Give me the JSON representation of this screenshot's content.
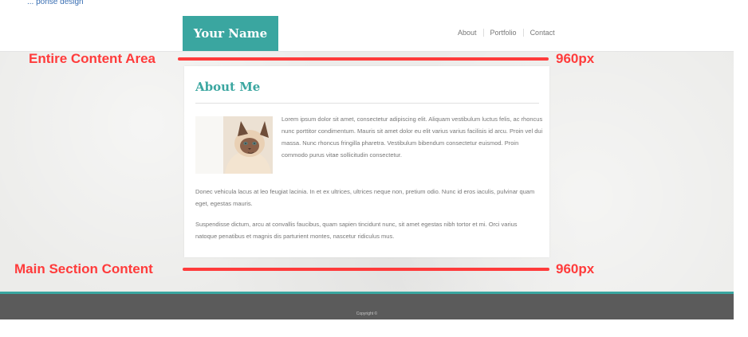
{
  "top_link": "... ponse design",
  "header": {
    "logo": "Your Name",
    "nav": [
      "About",
      "Portfolio",
      "Contact"
    ]
  },
  "main": {
    "title": "About Me",
    "paragraphs": [
      "Lorem ipsum dolor sit amet, consectetur adipiscing elit. Aliquam vestibulum luctus felis, ac rhoncus nunc porttitor condimentum. Mauris sit amet dolor eu elit varius varius facilisis id arcu. Proin vel dui massa. Nunc rhoncus fringilla pharetra. Vestibulum bibendum consectetur euismod. Proin commodo purus vitae sollicitudin consectetur.",
      "Donec vehicula lacus at leo feugiat lacinia. In et ex ultrices, ultrices neque non, pretium odio. Nunc id eros iaculis, pulvinar quam eget, egestas mauris.",
      "Suspendisse dictum, arcu at convallis faucibus, quam sapien tincidunt nunc, sit amet egestas nibh tortor et mi. Orci varius natoque penatibus et magnis dis parturient montes, nascetur ridiculus mus."
    ]
  },
  "annotations": {
    "entire_content_area": "Entire Content Area",
    "main_section_content": "Main Section Content",
    "width_1": "960px",
    "width_2": "960px"
  },
  "footer": {
    "copyright": "Copyright ©"
  },
  "colors": {
    "accent": "#3aa6a0",
    "annotation": "#ff3b3b",
    "footer": "#5b5b5b"
  }
}
